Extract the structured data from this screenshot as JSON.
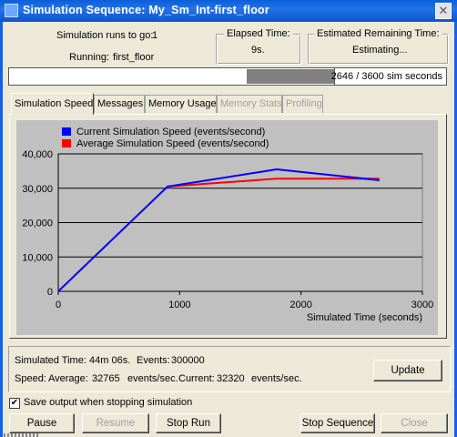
{
  "window": {
    "title": "Simulation Sequence: My_Sm_Int-first_floor",
    "close_glyph": "✕"
  },
  "header": {
    "runs_to_go_label": "Simulation runs to go:",
    "runs_to_go_value": "1",
    "running_label": "Running:",
    "running_value": "first_floor",
    "elapsed_label": "Elapsed Time:",
    "elapsed_value": "9s.",
    "remaining_label": "Estimated Remaining Time:",
    "remaining_value": "Estimating..."
  },
  "progress": {
    "text": "2646 / 3600 sim seconds",
    "fraction": 0.735
  },
  "tabs": [
    {
      "label": "Simulation Speed",
      "active": true,
      "enabled": true
    },
    {
      "label": "Messages",
      "active": false,
      "enabled": true
    },
    {
      "label": "Memory Usage",
      "active": false,
      "enabled": true
    },
    {
      "label": "Memory Stats",
      "active": false,
      "enabled": false
    },
    {
      "label": "Profiling",
      "active": false,
      "enabled": false
    }
  ],
  "chart_data": {
    "type": "line",
    "xlabel": "Simulated Time (seconds)",
    "ylabel": "",
    "xlim": [
      0,
      3000
    ],
    "ylim": [
      0,
      40000
    ],
    "x_ticks": [
      "0",
      "1000",
      "2000",
      "3000"
    ],
    "y_ticks": [
      "0",
      "10,000",
      "20,000",
      "30,000",
      "40,000"
    ],
    "y_tick_values": [
      0,
      10000,
      20000,
      30000,
      40000
    ],
    "grid": "horizontal",
    "legend_position": "top-left",
    "series": [
      {
        "name": "Current Simulation Speed (events/second)",
        "color": "#0000ff",
        "x": [
          0,
          900,
          1800,
          2646
        ],
        "y": [
          0,
          30500,
          35500,
          32320
        ]
      },
      {
        "name": "Average Simulation Speed (events/second)",
        "color": "#ff0000",
        "x": [
          900,
          1800,
          2646
        ],
        "y": [
          30500,
          32800,
          32765
        ]
      }
    ]
  },
  "status": {
    "sim_time_label": "Simulated Time:",
    "sim_time_value": "44m 06s.",
    "events_label": "Events:",
    "events_value": "300000",
    "speed_label": "Speed:",
    "average_label": "Average:",
    "average_value": "32765",
    "average_unit": "events/sec.",
    "current_label": "Current:",
    "current_value": "32320",
    "current_unit": "events/sec."
  },
  "buttons": {
    "update": "Update",
    "pause": "Pause",
    "resume": "Resume",
    "stop_run": "Stop Run",
    "stop_sequence": "Stop Sequence",
    "close": "Close"
  },
  "save_output": {
    "label": "Save output when stopping simulation",
    "checked": true,
    "check_glyph": "✔"
  }
}
